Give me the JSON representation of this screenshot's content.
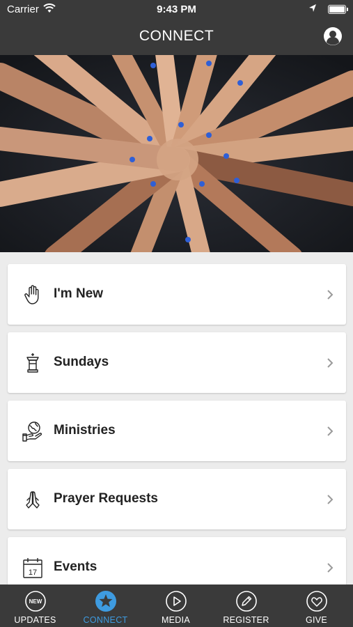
{
  "status_bar": {
    "carrier": "Carrier",
    "time": "9:43 PM"
  },
  "nav": {
    "title": "CONNECT"
  },
  "hero": {
    "description_icon": "hands-together-photo"
  },
  "menu": {
    "items": [
      {
        "label": "I'm New",
        "icon": "hand-wave-icon"
      },
      {
        "label": "Sundays",
        "icon": "pulpit-icon"
      },
      {
        "label": "Ministries",
        "icon": "globe-hand-icon"
      },
      {
        "label": "Prayer Requests",
        "icon": "praying-hands-icon"
      },
      {
        "label": "Events",
        "icon": "calendar-icon",
        "calendar_day": "17"
      }
    ]
  },
  "tabs": [
    {
      "label": "UPDATES",
      "icon": "new-badge-icon",
      "badge": "NEW",
      "active": false
    },
    {
      "label": "CONNECT",
      "icon": "star-icon",
      "active": true
    },
    {
      "label": "MEDIA",
      "icon": "play-icon",
      "active": false
    },
    {
      "label": "REGISTER",
      "icon": "pencil-icon",
      "active": false
    },
    {
      "label": "GIVE",
      "icon": "heart-icon",
      "active": false
    }
  ],
  "colors": {
    "bar": "#3a3a3a",
    "accent": "#3e9be0",
    "background": "#ececec"
  }
}
